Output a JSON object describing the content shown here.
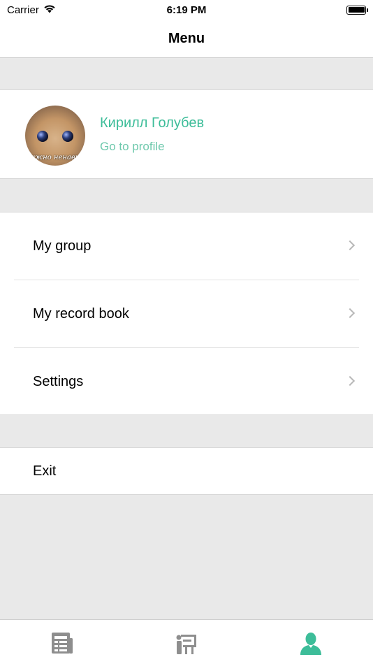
{
  "status_bar": {
    "carrier": "Carrier",
    "time": "6:19 PM",
    "icons": [
      "wifi-icon",
      "battery-icon"
    ]
  },
  "nav": {
    "title": "Menu"
  },
  "profile": {
    "name": "Кирилл Голубев",
    "link": "Go to profile",
    "avatar_caption": "нужно ненавид"
  },
  "menu": {
    "items": [
      {
        "label": "My group"
      },
      {
        "label": "My record book"
      },
      {
        "label": "Settings"
      }
    ],
    "exit_label": "Exit"
  },
  "tab_bar": {
    "tabs": [
      {
        "icon": "news-icon",
        "active": false
      },
      {
        "icon": "lecture-icon",
        "active": false
      },
      {
        "icon": "profile-icon",
        "active": true
      }
    ],
    "active_color": "#3dbd99",
    "inactive_color": "#8e8e8e"
  },
  "colors": {
    "accent": "#3dbd99",
    "background": "#e9e9e9"
  }
}
